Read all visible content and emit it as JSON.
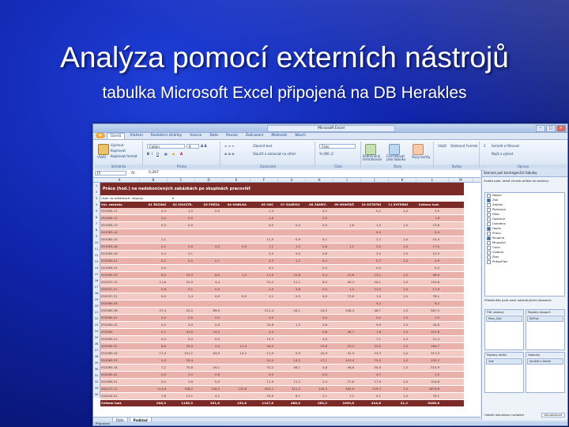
{
  "slide": {
    "title": "Analýza pomocí externích nástrojů",
    "subtitle": "tabulka Microsoft Excel připojená na DB Herakles"
  },
  "window": {
    "title": "Microsoft Excel"
  },
  "ribbon_tabs": [
    "Domů",
    "Vložení",
    "Rozložení stránky",
    "Vzorce",
    "Data",
    "Revize",
    "Zobrazení",
    "Možnosti",
    "Návrh"
  ],
  "ribbon": {
    "paste": "Vložit",
    "cut": "Vyjmout",
    "copy": "Kopírovat",
    "format_painter": "Kopírovat formát",
    "clipboard": "Schránka",
    "font_name": "Calibri",
    "font_size": "8",
    "font_group": "Písmo",
    "wrap": "Zalomit text",
    "merge": "Sloučit a zarovnat na střed",
    "alignment": "Zarovnání",
    "number_format": "Číslo",
    "number_group": "Číslo",
    "cond_format": "Podmíněné formátování",
    "format_table": "Formátovat jako tabulku",
    "cell_styles": "Styly buňky",
    "styles_group": "Styly",
    "insert": "Vložit",
    "delete": "Odstranit",
    "format": "Formát",
    "cells_group": "Buňky",
    "sort": "Seřadit a filtrovat",
    "find": "Najít a vybrat",
    "editing_group": "Úpravy"
  },
  "formula": {
    "namebox": "J5",
    "fx": "fx",
    "value": "0,267"
  },
  "columns": [
    "A",
    "B",
    "C",
    "D",
    "E",
    "F",
    "G",
    "H",
    "I",
    "J",
    "K",
    "L",
    "M"
  ],
  "sheet": {
    "title": "Práce (hod.) na nedokončených zakázkách po skupinách pracovišť",
    "filter_label": "Úsek na zakázkách: skupiny",
    "headers": [
      "Výr. zakázka",
      "01 ŘEZÁNÍ",
      "02 SOUSTR.",
      "03 FRÉZA",
      "04 HOBLKA",
      "05 CNC",
      "07 SVAŘOV.",
      "08 ZÁMEČ.",
      "09 MONTÁŽ",
      "10 OSTATNÍ",
      "11 EXTERNÍ",
      "Celkem hod."
    ],
    "rows": [
      [
        "051065-11",
        "0,4",
        "1,5",
        "0,0",
        "",
        "1,4",
        "",
        "0,2",
        "",
        "0,2",
        "1,0",
        "3,5"
      ],
      [
        "051065-12",
        "0,0",
        "0,0",
        "",
        "",
        "1,8",
        "",
        "0,0",
        "",
        "",
        "",
        "1,8"
      ],
      [
        "051065-13",
        "0,3",
        "0,9",
        "",
        "",
        "9,0",
        "0,4",
        "0,0",
        "1,6",
        "1,5",
        "1,0",
        "13,6"
      ],
      [
        "051065-14",
        "",
        "",
        "",
        "",
        "",
        "",
        "",
        "",
        "0,0",
        "",
        "0,0"
      ],
      [
        "051065-15",
        "1,1",
        "",
        "",
        "",
        "11,5",
        "0,9",
        "0,1",
        "",
        "1,7",
        "1,0",
        "15,4"
      ],
      [
        "051065-16",
        "0,1",
        "0,0",
        "0,0",
        "0,0",
        "7,1",
        "1,5",
        "0,6",
        "1,2",
        "3,0",
        "1,0",
        "17,5"
      ],
      [
        "051065-18",
        "0,4",
        "2,1",
        "",
        "",
        "5,5",
        "0,5",
        "0,6",
        "",
        "3,0",
        "1,0",
        "12,5"
      ],
      [
        "051065-21",
        "0,1",
        "0,5",
        "0,7",
        "",
        "5,3",
        "1,2",
        "0,4",
        "",
        "0,7",
        "1,0",
        "9,9"
      ],
      [
        "051065-31",
        "0,0",
        "",
        "",
        "",
        "9,2",
        "",
        "0,0",
        "",
        "0,0",
        "",
        "9,2"
      ],
      [
        "051065-32",
        "8,5",
        "25,9",
        "6,5",
        "1,2",
        "11,9",
        "10,8",
        "0,4",
        "19,8",
        "13,2",
        "1,0",
        "96,6"
      ],
      [
        "052057-12",
        "11,6",
        "20,9",
        "4,4",
        "",
        "31,2",
        "11,1",
        "6,0",
        "49,4",
        "18,1",
        "1,0",
        "154,6"
      ],
      [
        "052057-21",
        "0,6",
        "0,1",
        "0,0",
        "",
        "1,5",
        "3,8",
        "0,0",
        "1,3",
        "10,5",
        "1,0",
        "17,6"
      ],
      [
        "052057-31",
        "0,0",
        "2,4",
        "0,0",
        "0,9",
        "1,1",
        "0,0",
        "0,0",
        "73,6",
        "1,0",
        "1,0",
        "78,1"
      ],
      [
        "052060-35",
        "",
        "",
        "",
        "",
        "",
        "",
        "",
        "",
        "9,2",
        "",
        "9,2"
      ],
      [
        "052060-36",
        "27,4",
        "52,2",
        "89,9",
        "",
        "211,4",
        "44,1",
        "24,5",
        "108,4",
        "48,7",
        "1,0",
        "587,3"
      ],
      [
        "052060-41",
        "0,0",
        "0,0",
        "0,0",
        "",
        "0,0",
        "",
        "0,0",
        "",
        "0,0",
        "1,0",
        "1,0"
      ],
      [
        "052060-42",
        "0,0",
        "0,0",
        "0,0",
        "",
        "24,8",
        "1,3",
        "4,8",
        "",
        "9,0",
        "1,0",
        "40,8"
      ],
      [
        "052065",
        "0,1",
        "43,5",
        "24,0",
        "",
        "2,9",
        "",
        "0,8",
        "28,7",
        "7,6",
        "1,0",
        "107,6"
      ],
      [
        "052065-21",
        "0,0",
        "0,0",
        "0,0",
        "",
        "13,3",
        "",
        "0,0",
        "",
        "7,1",
        "1,0",
        "21,4"
      ],
      [
        "052065-31",
        "6,8",
        "35,9",
        "0,0",
        "11,5",
        "45,5",
        "",
        "25,6",
        "29,5",
        "33,0",
        "1,0",
        "189,7"
      ],
      [
        "052065-32",
        "17,0",
        "101,1",
        "83,9",
        "14,2",
        "11,9",
        "0,9",
        "20,9",
        "42,3",
        "23,3",
        "1,0",
        "317,3"
      ],
      [
        "052065-33",
        "0,9",
        "30,4",
        "",
        "",
        "41,4",
        "14,2",
        "27,1",
        "103,0",
        "75,0",
        "1,0",
        "293,2"
      ],
      [
        "052065-34",
        "7,2",
        "70,8",
        "49,1",
        "",
        "31,2",
        "58,1",
        "0,8",
        "46,8",
        "50,9",
        "1,0",
        "315,9"
      ],
      [
        "052065-41",
        "0,0",
        "2,0",
        "0,8",
        "",
        "0,0",
        "",
        "0,0",
        "",
        "4,7",
        "",
        "7,5"
      ],
      [
        "052065-51",
        "0,0",
        "2,6",
        "0,0",
        "",
        "11,9",
        "11,2",
        "2,4",
        "27,8",
        "17,9",
        "1,0",
        "104,6"
      ],
      [
        "062470-11",
        "114,6",
        "708,2",
        "128,3",
        "125,8",
        "603,1",
        "311,2",
        "144,3",
        "363,9",
        "179,3",
        "1,0",
        "2679,8"
      ],
      [
        "102042-31",
        "7,6",
        "13,1",
        "4,1",
        "",
        "23,9",
        "6,7",
        "2,1",
        "7,2",
        "9,1",
        "1,0",
        "76,1"
      ]
    ],
    "total": [
      "Celkem hod.",
      "206,9",
      "1158,3",
      "391,6",
      "153,6",
      "1147,8",
      "488,0",
      "263,2",
      "1009,8",
      "414,6",
      "21,2",
      "5408,6"
    ]
  },
  "sheet_tabs": [
    "Data",
    "Podklad"
  ],
  "status": "Připraven",
  "pane": {
    "header": "Seznam polí kontingenční tabulky",
    "instruction": "Zvolte pole, které chcete přidat do sestavy:",
    "fields": [
      {
        "name": "Nazev",
        "on": false
      },
      {
        "name": "Zak",
        "on": true
      },
      {
        "name": "ZakVar",
        "on": false
      },
      {
        "name": "Posloupn",
        "on": false
      },
      {
        "name": "Dilec",
        "on": false
      },
      {
        "name": "Operace",
        "on": false
      },
      {
        "name": "Uvedeno",
        "on": false
      },
      {
        "name": "Hodin",
        "on": true
      },
      {
        "name": "Praco",
        "on": false
      },
      {
        "name": "Skupina",
        "on": true
      },
      {
        "name": "Mnozstvi",
        "on": false
      },
      {
        "name": "Cena",
        "on": false
      },
      {
        "name": "Vydano",
        "on": false
      },
      {
        "name": "Stav",
        "on": false
      },
      {
        "name": "PrikazPlan",
        "on": false
      }
    ],
    "drag_label": "Přetáhněte pole mezi následujícími oblastmi:",
    "zone_filter": "Filtr sestavy",
    "zone_columns": "Popisky sloupců",
    "zone_rows": "Popisky řádků",
    "zone_values": "Hodnoty",
    "filter_item": "Poss_Zak",
    "column_item": "SkPrac",
    "row_item": "Zak",
    "value_item": "Součet z Hodin",
    "defer": "Odložit aktualizaci rozložení",
    "update": "Aktualizovat"
  }
}
